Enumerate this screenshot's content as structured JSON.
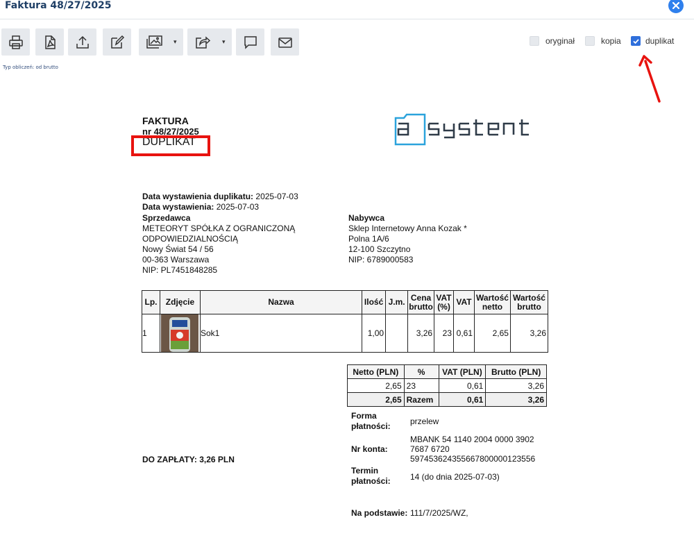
{
  "window": {
    "title": "Faktura 48/27/2025"
  },
  "toolbar": {
    "buttons": [
      {
        "icon": "print-icon"
      },
      {
        "icon": "pdf-icon"
      },
      {
        "icon": "export-icon"
      },
      {
        "icon": "edit-icon"
      },
      {
        "icon": "image-icon"
      },
      {
        "icon": "share-icon"
      },
      {
        "icon": "comment-icon"
      },
      {
        "icon": "mail-icon"
      }
    ],
    "caret": "▾"
  },
  "copy_options": {
    "original": {
      "label": "oryginał",
      "checked": false
    },
    "copy": {
      "label": "kopia",
      "checked": false
    },
    "duplicate": {
      "label": "duplikat",
      "checked": true
    }
  },
  "calc_type": "Typ obliczeń: od brutto",
  "invoice": {
    "title": "FAKTURA",
    "number": "nr 48/27/2025",
    "duplicate_label": "DUPLIKAT",
    "logo_text": "asystent",
    "duplicate_date_label": "Data wystawienia duplikatu:",
    "duplicate_date": "2025-07-03",
    "issue_date_label": "Data wystawienia:",
    "issue_date": "2025-07-03",
    "seller": {
      "heading": "Sprzedawca",
      "lines": [
        "METEORYT SPÓŁKA Z OGRANICZONĄ",
        "ODPOWIEDZIALNOŚCIĄ",
        "Nowy Świat 54 / 56",
        "00-363 Warszawa",
        "NIP: PL7451848285"
      ]
    },
    "buyer": {
      "heading": "Nabywca",
      "lines": [
        "Sklep Internetowy Anna Kozak *",
        "Polna 1A/6",
        "12-100 Szczytno",
        "NIP: 6789000583"
      ]
    },
    "items_table": {
      "headers": {
        "lp": "Lp.",
        "photo": "Zdjęcie",
        "name": "Nazwa",
        "qty": "Ilość",
        "unit": "J.m.",
        "price1": "Cena",
        "price2": "brutto",
        "vatp1": "VAT",
        "vatp2": "(%)",
        "vat": "VAT",
        "net1": "Wartość",
        "net2": "netto",
        "gross1": "Wartość",
        "gross2": "brutto"
      },
      "rows": [
        {
          "lp": "1",
          "name": "Sok1",
          "qty": "1,00",
          "unit": "",
          "price": "3,26",
          "vatp": "23",
          "vat": "0,61",
          "net": "2,65",
          "gross": "3,26"
        }
      ]
    },
    "summary_table": {
      "headers": {
        "net": "Netto (PLN)",
        "pct": "%",
        "vat": "VAT (PLN)",
        "gross": "Brutto (PLN)"
      },
      "row": {
        "net": "2,65",
        "pct": "23",
        "vat": "0,61",
        "gross": "3,26"
      },
      "total": {
        "net": "2,65",
        "label": "Razem",
        "vat": "0,61",
        "gross": "3,26"
      }
    },
    "payment": {
      "method_label1": "Forma",
      "method_label2": "płatności:",
      "method": "przelew",
      "account_label": "Nr konta:",
      "account_lines": [
        "MBANK 54 1140 2004 0000 3902",
        "7687 6720",
        "597453624355667800000123556"
      ],
      "term_label1": "Termin",
      "term_label2": "płatności:",
      "term": "14 (do dnia 2025-07-03)",
      "basis_label": "Na podstawie:",
      "basis": "111/7/2025/WZ,"
    },
    "to_pay": "DO ZAPŁATY: 3,26 PLN"
  },
  "colors": {
    "title": "#1f3f66",
    "accent": "#2f6fdb",
    "highlight": "#e8130f",
    "logo": "#2ba3dc",
    "toolbar_button": "#e6e9ed"
  }
}
